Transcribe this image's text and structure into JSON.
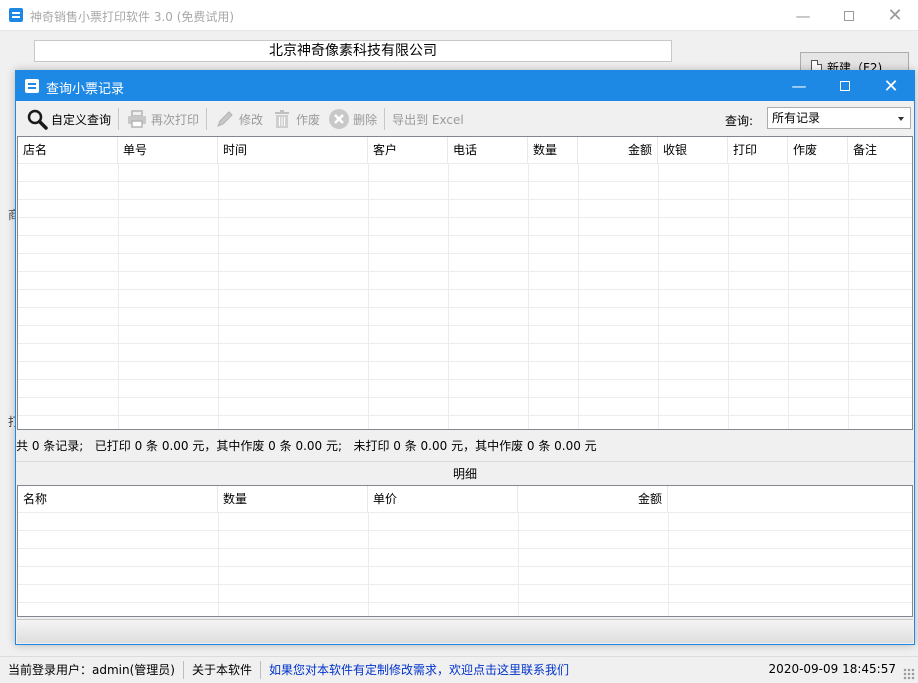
{
  "main_window": {
    "title": "神奇销售小票打印软件 3.0 (免费试用)",
    "company_name": "北京神奇像素科技有限公司",
    "new_button_label": "新建（F2)",
    "left_fragments": [
      "商",
      "打"
    ]
  },
  "dialog": {
    "title": "查询小票记录",
    "toolbar": {
      "custom_query": "自定义查询",
      "reprint": "再次打印",
      "edit": "修改",
      "void": "作废",
      "delete": "删除",
      "export_excel": "导出到 Excel",
      "query_label": "查询:",
      "query_selected": "所有记录"
    },
    "records_table": {
      "columns": [
        "店名",
        "单号",
        "时间",
        "客户",
        "电话",
        "数量",
        "金额",
        "收银",
        "打印",
        "作废",
        "备注"
      ],
      "rows": []
    },
    "summary": "共 0 条记录;   已打印 0 条 0.00 元，其中作废 0 条 0.00 元;   未打印 0 条 0.00 元，其中作废 0 条 0.00 元",
    "detail_label": "明细",
    "detail_table": {
      "columns": [
        "名称",
        "数量",
        "单价",
        "金额"
      ],
      "rows": []
    }
  },
  "statusbar": {
    "current_user": "当前登录用户：admin(管理员)",
    "about": "关于本软件",
    "contact_link": "如果您对本软件有定制修改需求，欢迎点击这里联系我们",
    "datetime": "2020-09-09 18:45:57"
  },
  "colors": {
    "accent": "#1e88e5",
    "link": "#0033cc"
  }
}
